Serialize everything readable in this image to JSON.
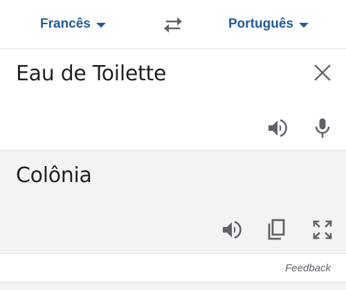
{
  "languages": {
    "source": "Francês",
    "target": "Português"
  },
  "source": {
    "text": "Eau de Toilette"
  },
  "translation": {
    "text": "Colônia"
  },
  "feedback_label": "Feedback",
  "icons": {
    "swap": "swap-arrows-icon",
    "dropdown": "caret-down-icon",
    "clear": "close-icon",
    "speak": "speaker-icon",
    "mic": "microphone-icon",
    "copy": "copy-icon",
    "expand": "fullscreen-icon"
  },
  "colors": {
    "accent": "#1f5aa6",
    "icon": "#5f6368",
    "translation_bg": "#f1f3f4",
    "text": "#202124"
  }
}
